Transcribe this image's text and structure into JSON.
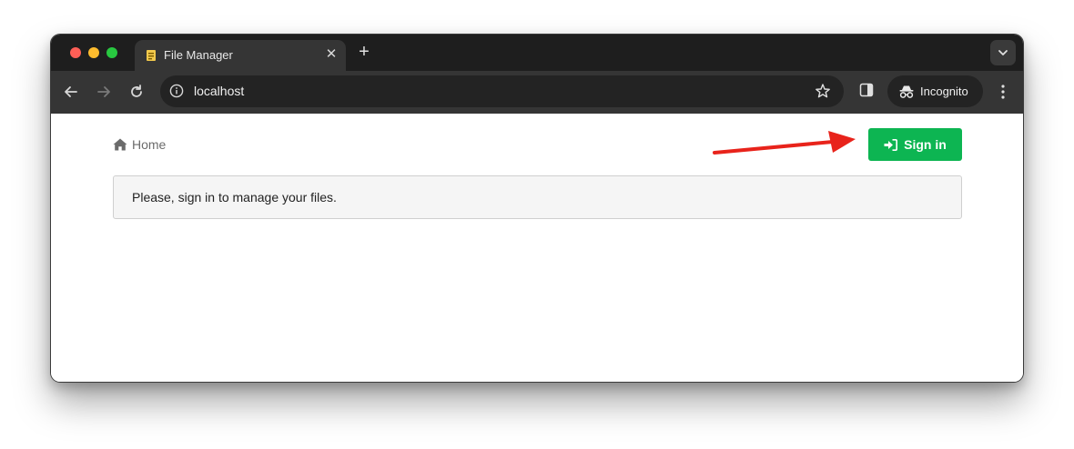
{
  "browser": {
    "tab": {
      "title": "File Manager",
      "close_glyph": "✕"
    },
    "new_tab_glyph": "+",
    "address_bar": {
      "url": "localhost"
    },
    "incognito_label": "Incognito"
  },
  "page": {
    "breadcrumb": {
      "home_label": "Home"
    },
    "sign_in_label": "Sign in",
    "alert_message": "Please, sign in to manage your files."
  },
  "colors": {
    "sign_in_button": "#0db552",
    "annotation_arrow": "#e8231b",
    "alert_background": "#f5f5f5"
  },
  "icons": {
    "home": "home-icon",
    "sign_in": "sign-in-icon",
    "incognito": "incognito-icon",
    "star": "star-icon",
    "info": "info-icon"
  }
}
